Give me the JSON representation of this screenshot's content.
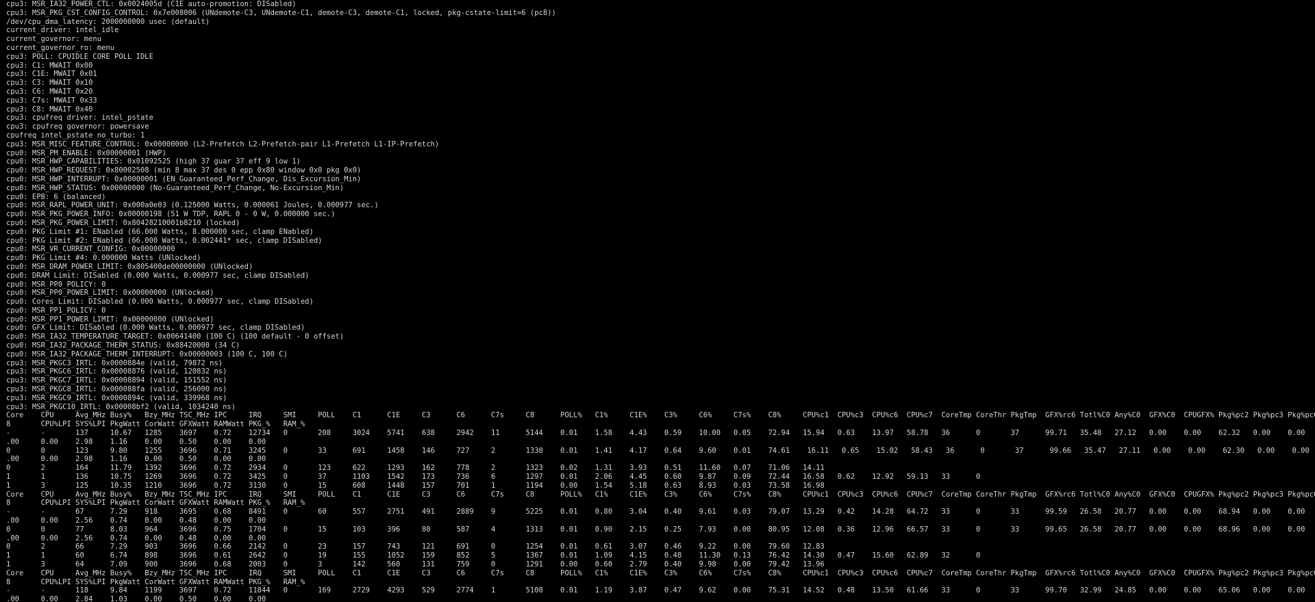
{
  "terminal": {
    "foreground": "#d6d6d6",
    "background": "#000000",
    "lines": [
      "cpu3: MSR_IA32_POWER_CTL: 0x0024005d (C1E auto-promotion: DISabled)",
      "cpu3: MSR_PKG_CST_CONFIG_CONTROL: 0x7e008006 (UNdemote-C3, UNdemote-C1, demote-C3, demote-C1, locked, pkg-cstate-limit=6 (pc8))",
      "/dev/cpu_dma_latency: 2000000000 usec (default)",
      "current_driver: intel_idle",
      "current_governor: menu",
      "current_governor_ro: menu",
      "cpu3: POLL: CPUIDLE CORE POLL IDLE",
      "cpu3: C1: MWAIT 0x00",
      "cpu3: C1E: MWAIT 0x01",
      "cpu3: C3: MWAIT 0x10",
      "cpu3: C6: MWAIT 0x20",
      "cpu3: C7s: MWAIT 0x33",
      "cpu3: C8: MWAIT 0x40",
      "cpu3: cpufreq driver: intel_pstate",
      "cpu3: cpufreq governor: powersave",
      "cpufreq intel_pstate no_turbo: 1",
      "cpu3: MSR_MISC_FEATURE_CONTROL: 0x00000000 (L2-Prefetch L2-Prefetch-pair L1-Prefetch L1-IP-Prefetch)",
      "cpu0: MSR_PM_ENABLE: 0x00000001 (HWP)",
      "cpu0: MSR_HWP_CAPABILITIES: 0x01092525 (high 37 guar 37 eff 9 low 1)",
      "cpu0: MSR_HWP_REQUEST: 0x80002508 (min 8 max 37 des 0 epp 0x80 window 0x0 pkg 0x0)",
      "cpu0: MSR_HWP_INTERRUPT: 0x00000001 (EN_Guaranteed_Perf_Change, Dis_Excursion_Min)",
      "cpu0: MSR_HWP_STATUS: 0x00000000 (No-Guaranteed_Perf_Change, No-Excursion_Min)",
      "cpu0: EPB: 6 (balanced)",
      "cpu0: MSR_RAPL_POWER_UNIT: 0x000a0e03 (0.125000 Watts, 0.000061 Joules, 0.000977 sec.)",
      "cpu0: MSR_PKG_POWER_INFO: 0x00000198 (51 W TDP, RAPL 0 - 0 W, 0.000000 sec.)",
      "cpu0: MSR_PKG_POWER_LIMIT: 0x80428210001b8210 (locked)",
      "cpu0: PKG Limit #1: ENabled (66.000 Watts, 8.000000 sec, clamp ENabled)",
      "cpu0: PKG Limit #2: ENabled (66.000 Watts, 0.002441* sec, clamp DISabled)",
      "cpu0: MSR_VR_CURRENT_CONFIG: 0x00000000",
      "cpu0: PKG Limit #4: 0.000000 Watts (UNlocked)",
      "cpu0: MSR_DRAM_POWER_LIMIT: 0x805400de00000000 (UNlocked)",
      "cpu0: DRAM Limit: DISabled (0.000 Watts, 0.000977 sec, clamp DISabled)",
      "cpu0: MSR_PP0_POLICY: 0",
      "cpu0: MSR_PP0_POWER_LIMIT: 0x00000000 (UNlocked)",
      "cpu0: Cores Limit: DISabled (0.000 Watts, 0.000977 sec, clamp DISabled)",
      "cpu0: MSR_PP1_POLICY: 0",
      "cpu0: MSR_PP1_POWER_LIMIT: 0x00000000 (UNlocked)",
      "cpu0: GFX Limit: DISabled (0.000 Watts, 0.000977 sec, clamp DISabled)",
      "cpu0: MSR_IA32_TEMPERATURE_TARGET: 0x00641400 (100 C) (100 default - 0 offset)",
      "cpu0: MSR_IA32_PACKAGE_THERM_STATUS: 0x88420000 (34 C)",
      "cpu0: MSR_IA32_PACKAGE_THERM_INTERRUPT: 0x00000003 (100 C, 100 C)",
      "cpu3: MSR_PKGC3_IRTL: 0x0000884e (valid, 79872 ns)",
      "cpu3: MSR_PKGC6_IRTL: 0x00008876 (valid, 120832 ns)",
      "cpu3: MSR_PKGC7_IRTL: 0x00008894 (valid, 151552 ns)",
      "cpu3: MSR_PKGC8_IRTL: 0x000088fa (valid, 256000 ns)",
      "cpu3: MSR_PKGC9_IRTL: 0x0000894c (valid, 339968 ns)",
      "cpu3: MSR_PKGC10_IRTL: 0x00008bf2 (valid, 1034240 ns)",
      "Core    CPU     Avg_MHz Busy%   Bzy_MHz TSC_MHz IPC     IRQ     SMI     POLL    C1      C1E     C3      C6      C7s     C8      POLL%   C1%     C1E%    C3%     C6%     C7s%    C8%     CPU%c1  CPU%c3  CPU%c6  CPU%c7  CoreTmp CoreThr PkgTmp  GFX%rc6 Totl%C0 Any%C0  GFX%C0  CPUGFX% Pkg%pc2 Pkg%pc3 Pkg%pc6 Pkg%pc7 Pkg%pc",
      "8       CPU%LPI SYS%LPI PkgWatt CorWatt GFXWatt RAMWatt PKG_%   RAM_%",
      "-       -       137     10.67   1285    3697    0.72    12734   0       208     3024    5741    638     2942    11      5144    0.01    1.58    4.43    0.59    10.00   0.05    72.94   15.94   0.63    13.97   58.78   36      0       37      99.71   35.48   27.12   0.00    0.00    62.32   0.00    0.00    0.00    0.00 0",
      ".00     0.00    2.98    1.16    0.00    0.50    0.00    0.00",
      "0       0       123     9.80    1255    3696    0.71    3245    0       33      691     1458    146     727     2       1330    0.01    1.41    4.17    0.64    9.60    0.01    74.61    16.11   0.65    15.02   58.43   36      0       37      99.66   35.47   27.11   0.00    0.00    62.30   0.00    0.00    0.00    0.00 0",
      ".00     0.00    2.98    1.16    0.00    0.50    0.00    0.00",
      "0       2       164     11.79   1392    3696    0.72    2934    0       123     622     1293    162     778     2       1323    0.02    1.31    3.93    0.51    11.60   0.07    71.06   14.11",
      "1       1       136     10.75   1269    3696    0.72    3425    0       37      1103    1542    173     736     6       1297    0.01    2.06    4.45    0.60    9.87    0.09    72.44   16.58   0.62    12.92   59.13   33      0",
      "1       3       125     10.35   1210    3696    0.72    3130    0       15      608     1448    157     701     1       1194    0.00    1.54    5.18    0.63    8.93    0.03    73.58   16.98",
      "Core    CPU     Avg_MHz Busy%   Bzy_MHz TSC_MHz IPC     IRQ     SMI     POLL    C1      C1E     C3      C6      C7s     C8      POLL%   C1%     C1E%    C3%     C6%     C7s%    C8%     CPU%c1  CPU%c3  CPU%c6  CPU%c7  CoreTmp CoreThr PkgTmp  GFX%rc6 Totl%C0 Any%C0  GFX%C0  CPUGFX% Pkg%pc2 Pkg%pc3 Pkg%pc6 Pkg%pc7 Pkg%pc",
      "8       CPU%LPI SYS%LPI PkgWatt CorWatt GFXWatt RAMWatt PKG_%   RAM_%",
      "-       -       67      7.29    918     3695    0.68    8491    0       60      557     2751    491     2889    9       5225    0.01    0.80    3.04    0.40    9.61    0.03    79.07   13.29   0.42    14.28   64.72   33      0       33      99.59   26.58   20.77   0.00    0.00    68.94   0.00    0.00    0.00    0.00 0",
      ".00     0.00    2.56    0.74    0.00    0.48    0.00    0.00",
      "0       0       77      8.03    964     3696    0.75    1704    0       15      103     396     80      587     4       1313    0.01    0.90    2.15    0.25    7.93    0.00    80.95   12.08   0.36    12.96   66.57   33      0       33      99.65   26.58   20.77   0.00    0.00    68.96   0.00    0.00    0.00    0.00 0",
      ".00     0.00    2.56    0.74    0.00    0.48    0.00    0.00",
      "0       2       66      7.29    903     3696    0.66    2142    0       23      157     743     121     691     0       1254    0.01    0.61    3.07    0.46    9.22    0.00    79.60   12.83",
      "1       1       60      6.74    898     3696    0.61    2642    0       19      155     1052    159     852     5       1367    0.01    1.09    4.15    0.48    11.30   0.13    76.42   14.30   0.47    15.60   62.89   32      0",
      "1       3       64      7.09    900     3696    0.68    2003    0       3       142     560     131     759     0       1291    0.00    0.60    2.79    0.40    9.98    0.00    79.42   13.96",
      "Core    CPU     Avg_MHz Busy%   Bzy_MHz TSC_MHz IPC     IRQ     SMI     POLL    C1      C1E     C3      C6      C7s     C8      POLL%   C1%     C1E%    C3%     C6%     C7s%    C8%     CPU%c1  CPU%c3  CPU%c6  CPU%c7  CoreTmp CoreThr PkgTmp  GFX%rc6 Totl%C0 Any%C0  GFX%C0  CPUGFX% Pkg%pc2 Pkg%pc3 Pkg%pc6 Pkg%pc7 Pkg%pc",
      "8       CPU%LPI SYS%LPI PkgWatt CorWatt GFXWatt RAMWatt PKG_%   RAM_%",
      "-       -       118     9.84    1199    3697    0.72    11844   0       169     2729    4293    529     2774    1       5108    0.01    1.19    3.87    0.47    9.62    0.00    75.31   14.52   0.48    13.50   61.66   33      0       33      99.70   32.99   24.85   0.00    0.00    65.06   0.00    0.00    0.00    0.00 0",
      ".00     0.00    2.84    1.03    0.00    0.50    0.00    0.00"
    ]
  }
}
